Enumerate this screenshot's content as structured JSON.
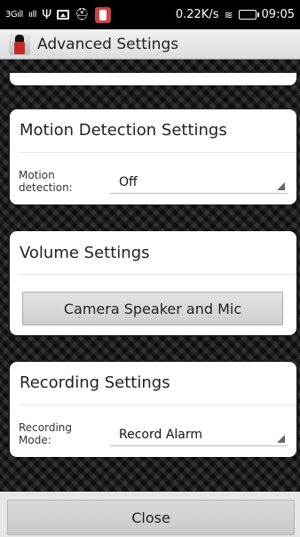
{
  "status_bar": {
    "signal_1": "3Gıll",
    "signal_2": "ııll",
    "speed": "0.22K/s",
    "time": "09:05",
    "icons": [
      "signal-icon",
      "signal-icon",
      "usb-icon",
      "image-icon",
      "app-notification-icon",
      "app-icon",
      "wifi-icon",
      "battery-icon"
    ]
  },
  "action_bar": {
    "title": "Advanced Settings",
    "icon": "app-logo-icon"
  },
  "motion": {
    "title": "Motion Detection Settings",
    "field_label_line1": "Motion",
    "field_label_line2": "detection:",
    "value": "Off"
  },
  "volume": {
    "title": "Volume Settings",
    "button_label": "Camera Speaker and Mic"
  },
  "recording": {
    "title": "Recording Settings",
    "field_label_line1": "Recording",
    "field_label_line2": "Mode:",
    "value": "Record Alarm"
  },
  "footer": {
    "close_label": "Close"
  },
  "colors": {
    "card_bg": "#ffffff",
    "background": "#1a1a1a",
    "action_bar": "#e8e8e8",
    "button": "#d4d4d4"
  }
}
